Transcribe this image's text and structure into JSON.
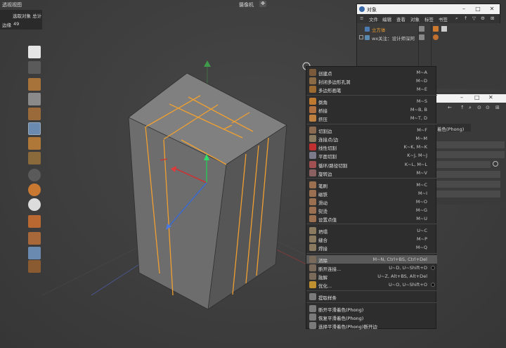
{
  "viewport": {
    "title": "透视视图",
    "camera_label": "摄像机",
    "info_selected": "选取对象 总计",
    "info_edges_label": "边缘",
    "info_edges_value": "49"
  },
  "object_manager": {
    "title": "对象",
    "menu": [
      "文件",
      "编辑",
      "查看",
      "对象",
      "标签",
      "书签"
    ],
    "objects": [
      {
        "name": "立方体"
      },
      {
        "name": "wx关注：设计师深阿"
      }
    ]
  },
  "attribute_panel": {
    "phong_label": "着色(Phong)"
  },
  "context_menu": {
    "groups": [
      [
        {
          "label": "创建点",
          "shortcut": "M~A",
          "icon": "create-point-icon",
          "color": "#7a5a3a"
        },
        {
          "label": "封闭多边形孔洞",
          "shortcut": "M~D",
          "icon": "close-hole-icon",
          "color": "#8a6a44"
        },
        {
          "label": "多边形画笔",
          "shortcut": "M~E",
          "icon": "polygon-pen-icon",
          "color": "#9a6a30"
        }
      ],
      [
        {
          "label": "倒角",
          "shortcut": "M~S",
          "icon": "bevel-icon",
          "color": "#c07a30"
        },
        {
          "label": "桥接",
          "shortcut": "M~B, B",
          "icon": "bridge-icon",
          "color": "#b07040"
        },
        {
          "label": "挤压",
          "shortcut": "M~T, D",
          "icon": "extrude-icon",
          "color": "#c08040"
        }
      ],
      [
        {
          "label": "切割边",
          "shortcut": "M~F",
          "icon": "cut-edges-icon",
          "color": "#8a6a50"
        },
        {
          "label": "连接点/边",
          "shortcut": "M~M",
          "icon": "connect-icon",
          "color": "#8a7a60"
        },
        {
          "label": "线性切割",
          "shortcut": "K~K, M~K",
          "icon": "line-cut-icon",
          "color": "#c03030"
        },
        {
          "label": "平面切割",
          "shortcut": "K~J, M~J",
          "icon": "plane-cut-icon",
          "color": "#7a7a8a"
        },
        {
          "label": "循环/路径切割",
          "shortcut": "K~L, M~L",
          "icon": "loop-cut-icon",
          "color": "#a05050"
        },
        {
          "label": "旋转边",
          "shortcut": "M~V",
          "icon": "spin-edge-icon",
          "color": "#8a6060"
        }
      ],
      [
        {
          "label": "笔刷",
          "shortcut": "M~C",
          "icon": "brush-icon",
          "color": "#9a7050"
        },
        {
          "label": "磁铁",
          "shortcut": "M~I",
          "icon": "magnet-icon",
          "color": "#9a7050"
        },
        {
          "label": "滑动",
          "shortcut": "M~O",
          "icon": "slide-icon",
          "color": "#9a7050"
        },
        {
          "label": "熨烫",
          "shortcut": "M~G",
          "icon": "iron-icon",
          "color": "#9a7050"
        },
        {
          "label": "设置点值",
          "shortcut": "M~U",
          "icon": "set-point-value-icon",
          "color": "#9a7050"
        }
      ],
      [
        {
          "label": "坍塌",
          "shortcut": "U~C",
          "icon": "collapse-icon",
          "color": "#8a7a60"
        },
        {
          "label": "缝合",
          "shortcut": "M~P",
          "icon": "stitch-icon",
          "color": "#8a7a60"
        },
        {
          "label": "焊接",
          "shortcut": "M~Q",
          "icon": "weld-icon",
          "color": "#8a7a60"
        }
      ],
      [
        {
          "label": "消除",
          "shortcut": "M~N, Ctrl+BS, Ctrl+Del",
          "icon": "dissolve-icon",
          "color": "#7a6a5a",
          "highlight": true
        },
        {
          "label": "断开连接...",
          "shortcut": "U~D, U~Shift+D",
          "icon": "disconnect-icon",
          "color": "#7a6a5a",
          "gear": true
        },
        {
          "label": "融解",
          "shortcut": "U~Z, Alt+BS, Alt+Del",
          "icon": "melt-icon",
          "color": "#7a6a5a"
        },
        {
          "label": "优化...",
          "shortcut": "U~O, U~Shift+O",
          "icon": "optimize-icon",
          "color": "#c09030",
          "gear": true
        }
      ],
      [
        {
          "label": "提取样条",
          "shortcut": "",
          "icon": "edge-to-spline-icon",
          "color": "#7a7a7a"
        }
      ],
      [
        {
          "label": "断开平滑着色(Phong)",
          "shortcut": "",
          "icon": "break-phong-icon",
          "color": "#7a7a7a"
        },
        {
          "label": "恢复平滑着色(Phong)",
          "shortcut": "",
          "icon": "unbreak-phong-icon",
          "color": "#7a7a7a"
        },
        {
          "label": "选择平滑着色(Phong)断开边",
          "shortcut": "",
          "icon": "select-phong-break-icon",
          "color": "#7a7a7a"
        }
      ]
    ]
  },
  "colors": {
    "edge_highlight": "#f0a030",
    "cube_top": "#7d7d7d",
    "cube_left": "#6e6e6e",
    "cube_right": "#555555"
  }
}
